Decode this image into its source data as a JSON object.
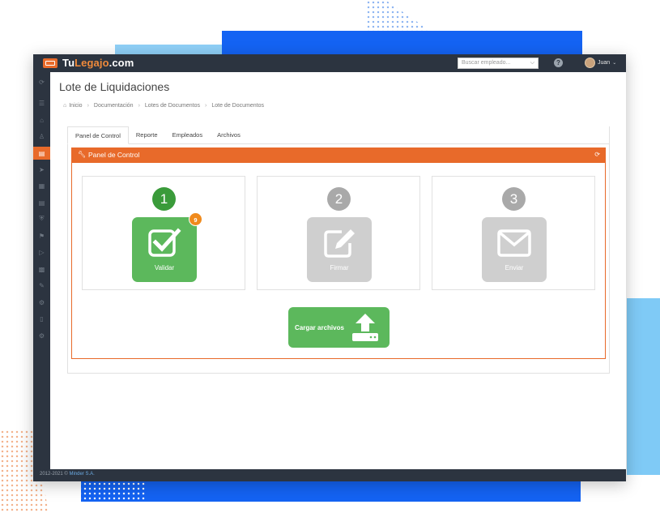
{
  "app": {
    "logo_text_1": "Tu",
    "logo_text_2": "Legajo",
    "logo_text_3": ".com",
    "search_placeholder": "Buscar empleado...",
    "user_name": "Juan"
  },
  "page": {
    "title": "Lote de Liquidaciones",
    "breadcrumb": [
      "Inicio",
      "Documentación",
      "Lotes de Documentos",
      "Lote de Documentos"
    ]
  },
  "tabs": [
    "Panel de Control",
    "Reporte",
    "Empleados",
    "Archivos"
  ],
  "panel": {
    "title": "Panel de Control",
    "steps": [
      {
        "number": "1",
        "label": "Validar",
        "badge": "9",
        "color": "#5cb85c",
        "number_color": "#3a9b3a",
        "icon": "check-icon"
      },
      {
        "number": "2",
        "label": "Firmar",
        "color": "#cfcfcf",
        "number_color": "#a9a9a9",
        "icon": "edit-icon"
      },
      {
        "number": "3",
        "label": "Enviar",
        "color": "#cfcfcf",
        "number_color": "#a9a9a9",
        "icon": "envelope-icon"
      }
    ],
    "upload_label": "Cargar archivos"
  },
  "footer": {
    "years": "2012-2021 ©",
    "company": "Minder S.A."
  },
  "colors": {
    "accent": "#e86a2a",
    "dark": "#2c3440",
    "success": "#5cb85c"
  }
}
